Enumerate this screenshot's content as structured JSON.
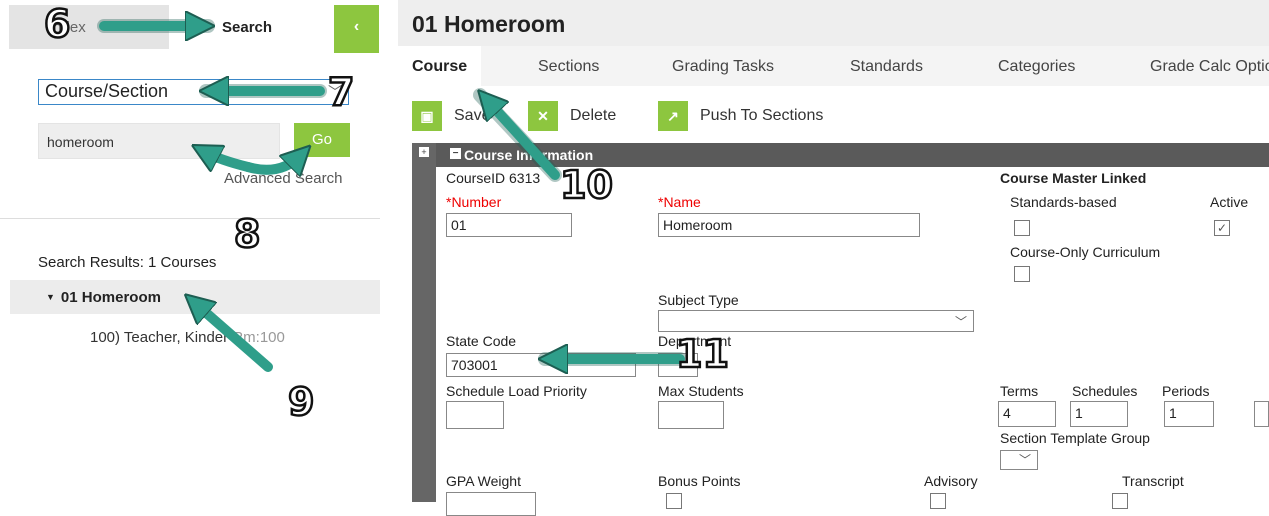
{
  "left": {
    "tab_index_label": "Index",
    "tab_search_label": "Search",
    "collapse_icon": "chevron-left-icon",
    "search_type_value": "Course/Section",
    "search_query_value": "homeroom",
    "go_label": "Go",
    "advanced_search_label": "Advanced Search",
    "results_label": "Search Results: 1 Courses",
    "result": {
      "title": "01 Homeroom",
      "section_text": "100) Teacher, Kinder",
      "room_text": "Rm:100"
    }
  },
  "right": {
    "page_title": "01 Homeroom",
    "tabs": [
      "Course",
      "Sections",
      "Grading Tasks",
      "Standards",
      "Categories",
      "Grade Calc Options"
    ],
    "toolbar": {
      "save_label": "Save",
      "delete_label": "Delete",
      "push_label": "Push To Sections"
    },
    "section_title": "Course Information",
    "form": {
      "course_id_label": "CourseID 6313",
      "number_label": "*Number",
      "number_value": "01",
      "name_label": "*Name",
      "name_value": "Homeroom",
      "course_master_linked_label": "Course Master Linked",
      "standards_based_label": "Standards-based",
      "active_label": "Active",
      "active_check": "✓",
      "course_only_curriculum_label": "Course-Only Curriculum",
      "subject_type_label": "Subject Type",
      "state_code_label": "State Code",
      "state_code_value": "703001",
      "department_label": "Department",
      "schedule_load_priority_label": "Schedule Load Priority",
      "max_students_label": "Max Students",
      "terms_label": "Terms",
      "terms_value": "4",
      "schedules_label": "Schedules",
      "schedules_value": "1",
      "periods_label": "Periods",
      "periods_value": "1",
      "section_template_group_label": "Section Template Group",
      "gpa_weight_label": "GPA Weight",
      "bonus_points_label": "Bonus Points",
      "advisory_label": "Advisory",
      "transcript_label": "Transcript"
    }
  },
  "annotations": {
    "n6": "6",
    "n7": "7",
    "n8": "8",
    "n9": "9",
    "n10": "10",
    "n11": "11"
  },
  "colors": {
    "accent_green": "#8dc63f",
    "arrow_teal": "#2f9e8a"
  }
}
